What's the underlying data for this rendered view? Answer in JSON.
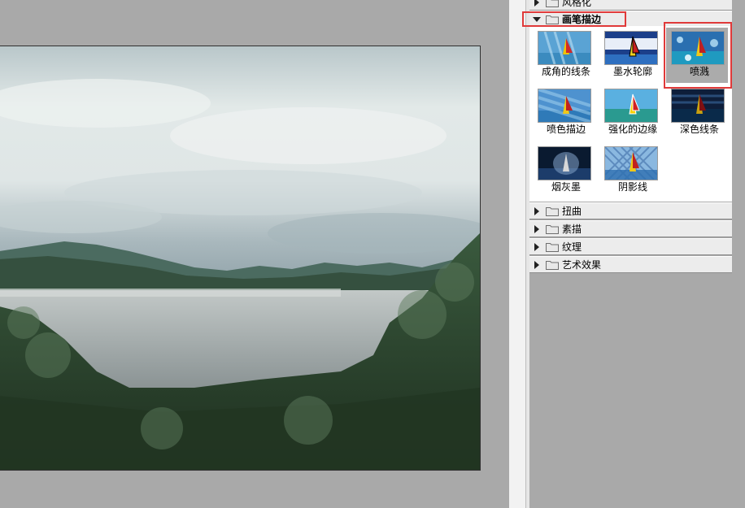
{
  "preview": {
    "description_colors": {
      "sky_top": "#c4cfd2",
      "sky_mid": "#e6eceb",
      "hills": "#3f5a4e",
      "water": "#9ba2a3",
      "vegetation": "#2a3f2a"
    }
  },
  "filter_gallery": {
    "categories_top": [
      {
        "label": "风格化",
        "expanded": false
      },
      {
        "label": "画笔描边",
        "expanded": true
      }
    ],
    "filters": [
      {
        "label": "成角的线条",
        "icon": "angled-strokes-thumbnail"
      },
      {
        "label": "墨水轮廓",
        "icon": "ink-outlines-thumbnail"
      },
      {
        "label": "喷溅",
        "icon": "spatter-thumbnail",
        "selected": true
      },
      {
        "label": "喷色描边",
        "icon": "sprayed-strokes-thumbnail"
      },
      {
        "label": "强化的边缘",
        "icon": "accented-edges-thumbnail"
      },
      {
        "label": "深色线条",
        "icon": "dark-strokes-thumbnail"
      },
      {
        "label": "烟灰墨",
        "icon": "sumi-e-thumbnail"
      },
      {
        "label": "阴影线",
        "icon": "crosshatch-thumbnail"
      }
    ],
    "categories_bottom": [
      {
        "label": "扭曲",
        "expanded": false
      },
      {
        "label": "素描",
        "expanded": false
      },
      {
        "label": "纹理",
        "expanded": false
      },
      {
        "label": "艺术效果",
        "expanded": false
      }
    ]
  },
  "colors": {
    "highlight": "#e03a3a",
    "panel_bg": "#ececec",
    "selected_bg": "#ababab"
  }
}
